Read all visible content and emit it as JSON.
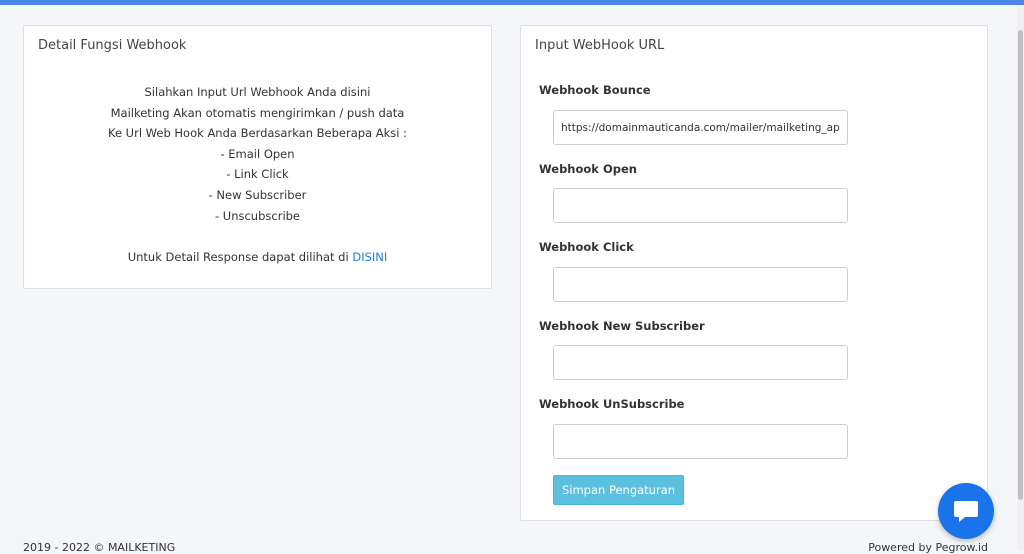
{
  "left_panel": {
    "title": "Detail Fungsi Webhook",
    "lines": [
      "Silahkan Input Url Webhook Anda disini",
      "Mailketing Akan otomatis mengirimkan / push data",
      "Ke Url Web Hook Anda Berdasarkan Beberapa Aksi :",
      "- Email Open",
      "- Link Click",
      "- New Subscriber",
      "- Unscubscribe"
    ],
    "detail_text": "Untuk Detail Response dapat dilihat di ",
    "detail_link": "DISINI"
  },
  "right_panel": {
    "title": "Input WebHook URL",
    "fields": [
      {
        "label": "Webhook Bounce",
        "value": "https://domainmauticanda.com/mailer/mailketing_api/callback"
      },
      {
        "label": "Webhook Open",
        "value": ""
      },
      {
        "label": "Webhook Click",
        "value": ""
      },
      {
        "label": "Webhook New Subscriber",
        "value": ""
      },
      {
        "label": "Webhook UnSubscribe",
        "value": ""
      }
    ],
    "save_label": "Simpan Pengaturan"
  },
  "footer": {
    "copyright": "2019 - 2022 © MAILKETING",
    "powered": "Powered by Pegrow.id"
  },
  "colors": {
    "topbar": "#4a86e8",
    "link": "#1a7fd4",
    "save_button": "#5bc0de",
    "chat_button": "#1a73e8"
  },
  "icons": {
    "chat": "chat-bubble-icon"
  }
}
